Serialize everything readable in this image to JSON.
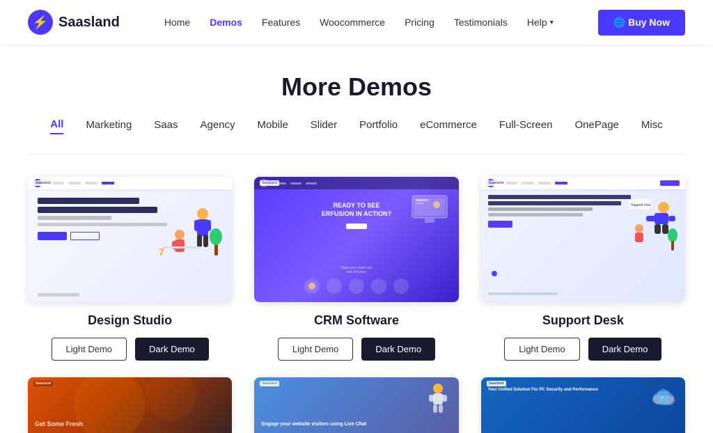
{
  "logo": {
    "icon": "⚡",
    "text": "Saasland"
  },
  "nav": {
    "items": [
      {
        "label": "Home",
        "active": false
      },
      {
        "label": "Demos",
        "active": true
      },
      {
        "label": "Features",
        "active": false
      },
      {
        "label": "Woocommerce",
        "active": false
      },
      {
        "label": "Pricing",
        "active": false
      },
      {
        "label": "Testimonials",
        "active": false
      },
      {
        "label": "Help",
        "active": false,
        "hasDropdown": true
      }
    ],
    "buy_button": "🌐 Buy Now"
  },
  "page": {
    "title": "More Demos"
  },
  "filter_tabs": [
    {
      "label": "All",
      "active": true
    },
    {
      "label": "Marketing",
      "active": false
    },
    {
      "label": "Saas",
      "active": false
    },
    {
      "label": "Agency",
      "active": false
    },
    {
      "label": "Mobile",
      "active": false
    },
    {
      "label": "Slider",
      "active": false
    },
    {
      "label": "Portfolio",
      "active": false
    },
    {
      "label": "eCommerce",
      "active": false
    },
    {
      "label": "Full-Screen",
      "active": false
    },
    {
      "label": "OnePage",
      "active": false
    },
    {
      "label": "Misc",
      "active": false
    }
  ],
  "demos": [
    {
      "id": "design-studio",
      "title": "Design Studio",
      "light_label": "Light Demo",
      "dark_label": "Dark Demo",
      "preview_type": "design-studio"
    },
    {
      "id": "crm-software",
      "title": "CRM Software",
      "light_label": "Light Demo",
      "dark_label": "Dark Demo",
      "preview_type": "crm"
    },
    {
      "id": "support-desk",
      "title": "Support Desk",
      "light_label": "Light Demo",
      "dark_label": "Dark Demo",
      "preview_type": "support"
    }
  ],
  "bottom_demos": [
    {
      "id": "bottom-1",
      "preview_type": "bottom-left",
      "content": "Get Some Fresh"
    },
    {
      "id": "bottom-2",
      "preview_type": "bottom-mid",
      "content": "Engage your website visitors using Live Chat"
    },
    {
      "id": "bottom-3",
      "preview_type": "bottom-right",
      "content": "Your Unified Solution For PC Security and Performance"
    }
  ]
}
